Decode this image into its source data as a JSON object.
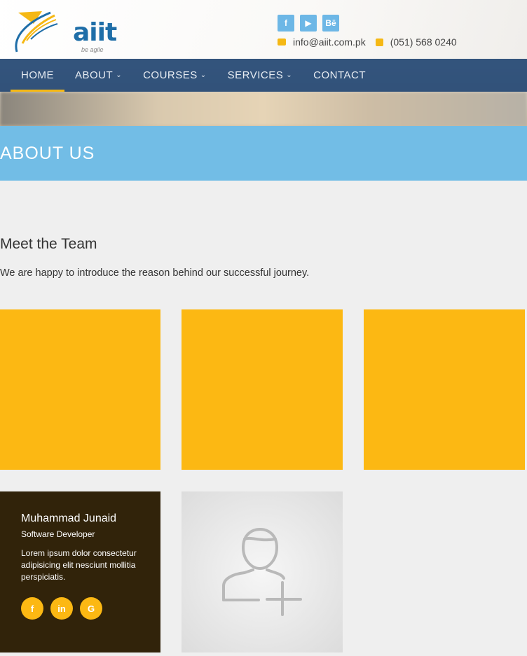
{
  "brand": {
    "name": "aiit",
    "tagline": "be agile"
  },
  "header": {
    "social": [
      {
        "icon": "facebook-icon",
        "glyph": "f"
      },
      {
        "icon": "youtube-icon",
        "glyph": "▶"
      },
      {
        "icon": "behance-icon",
        "glyph": "Bē"
      }
    ],
    "email": "info@aiit.com.pk",
    "phone": "(051) 568 0240"
  },
  "nav": {
    "items": [
      {
        "label": "HOME",
        "active": true
      },
      {
        "label": "ABOUT",
        "dropdown": true
      },
      {
        "label": "COURSES",
        "dropdown": true
      },
      {
        "label": "SERVICES",
        "dropdown": true
      },
      {
        "label": "CONTACT"
      }
    ]
  },
  "banner": {
    "title": "ABOUT US"
  },
  "team": {
    "title": "Meet the Team",
    "intro": "We are happy to introduce the reason behind our successful journey.",
    "member": {
      "name": "Muhammad Junaid",
      "role": "Software Developer",
      "bio": "Lorem ipsum dolor consectetur adipisicing elit nesciunt mollitia perspiciatis.",
      "social": [
        {
          "icon": "facebook-icon",
          "glyph": "f"
        },
        {
          "icon": "linkedin-icon",
          "glyph": "in"
        },
        {
          "icon": "google-icon",
          "glyph": "G"
        }
      ]
    }
  },
  "colors": {
    "accent": "#fcb813",
    "nav": "#234673",
    "banner": "#72bde6",
    "profile_bg": "#31230a"
  }
}
